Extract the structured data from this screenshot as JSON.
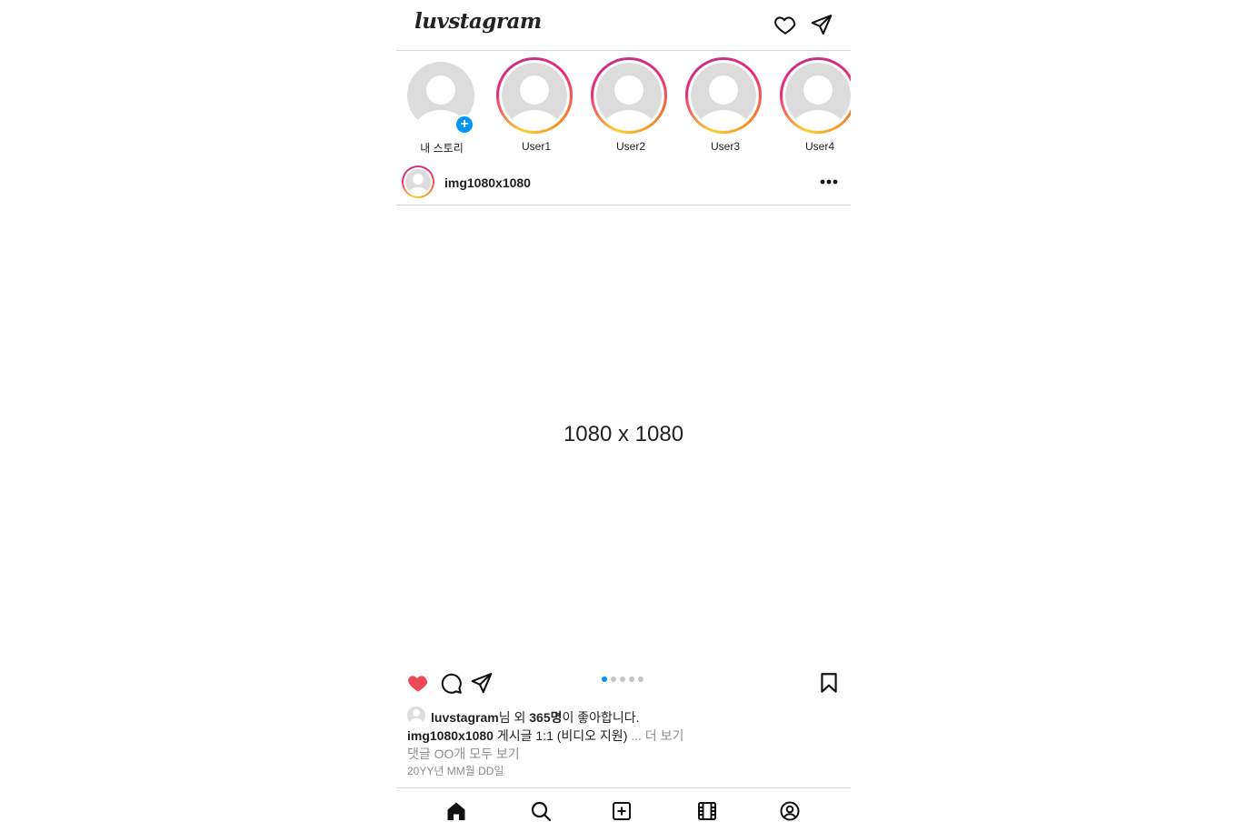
{
  "header": {
    "logo": "luvstagram",
    "icons": [
      "heart-icon",
      "send-icon"
    ]
  },
  "stories": [
    {
      "name": "내 스토리",
      "own": true
    },
    {
      "name": "User1"
    },
    {
      "name": "User2"
    },
    {
      "name": "User3"
    },
    {
      "name": "User4"
    }
  ],
  "post": {
    "author": "img1080x1080",
    "media_label": "1080 x 1080",
    "carousel": {
      "count": 5,
      "active": 0
    },
    "liked_by": "luvstagram",
    "likes_suffix_1": "님 외 ",
    "likes_count": "365명",
    "likes_suffix_2": "이 좋아합니다.",
    "caption_author": "img1080x1080",
    "caption_text": " 게시글 1:1 (비디오 지원)",
    "more_label": " ... 더 보기",
    "comments_label": "댓글 OO개 모두 보기",
    "date": "20YY년 MM월 DD일"
  },
  "colors": {
    "like": "#ed4956",
    "accent": "#0095f6",
    "muted": "#8e8e8e"
  },
  "bottom_nav": [
    "home-icon",
    "search-icon",
    "new-post-icon",
    "reels-icon",
    "profile-icon"
  ]
}
